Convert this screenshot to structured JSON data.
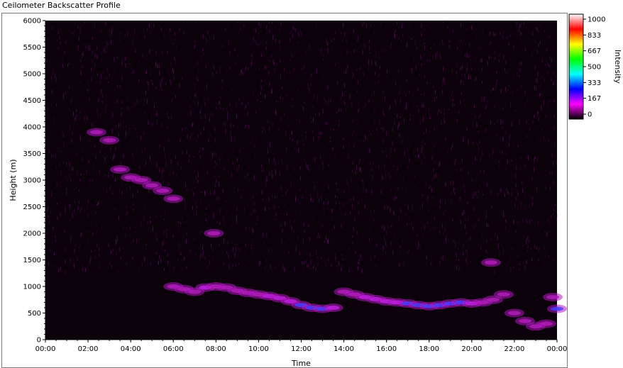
{
  "window": {
    "title": "Ceilometer Backscatter Profile"
  },
  "chart_data": {
    "type": "heatmap",
    "title": "Ceilometer Backscatter Profile",
    "xlabel": "Time",
    "ylabel": "Height (m)",
    "x_ticks": [
      "00:00",
      "02:00",
      "04:00",
      "06:00",
      "08:00",
      "10:00",
      "12:00",
      "14:00",
      "16:00",
      "18:00",
      "20:00",
      "22:00",
      "00:00"
    ],
    "x_range_hours": [
      0,
      24
    ],
    "y_ticks": [
      0,
      500,
      1000,
      1500,
      2000,
      2500,
      3000,
      3500,
      4000,
      4500,
      5000,
      5500,
      6000
    ],
    "ylim": [
      0,
      6000
    ],
    "colorbar": {
      "label": "Intensity",
      "ticks": [
        0,
        167,
        333,
        500,
        667,
        833,
        1000
      ],
      "range": [
        0,
        1000
      ],
      "colors": [
        "#000000",
        "#ff00ff",
        "#0000ff",
        "#00ffff",
        "#00ff00",
        "#ffff00",
        "#ff0000",
        "#ffffff"
      ]
    },
    "grid": false,
    "features": [
      {
        "name": "main-layer",
        "points": [
          [
            6.0,
            1000,
            300
          ],
          [
            6.5,
            950,
            320
          ],
          [
            7.0,
            900,
            300
          ],
          [
            7.5,
            980,
            330
          ],
          [
            8.0,
            1000,
            320
          ],
          [
            8.5,
            980,
            300
          ],
          [
            9.0,
            920,
            300
          ],
          [
            9.5,
            880,
            300
          ],
          [
            10.0,
            850,
            310
          ],
          [
            10.5,
            820,
            330
          ],
          [
            11.0,
            780,
            360
          ],
          [
            11.5,
            720,
            380
          ],
          [
            12.0,
            650,
            420
          ],
          [
            12.5,
            600,
            460
          ],
          [
            13.0,
            580,
            440
          ],
          [
            13.5,
            600,
            380
          ],
          [
            14.0,
            900,
            320
          ],
          [
            14.5,
            850,
            320
          ],
          [
            15.0,
            800,
            330
          ],
          [
            15.5,
            760,
            340
          ],
          [
            16.0,
            720,
            360
          ],
          [
            16.5,
            700,
            380
          ],
          [
            17.0,
            680,
            400
          ],
          [
            17.5,
            650,
            420
          ],
          [
            18.0,
            630,
            440
          ],
          [
            18.5,
            650,
            440
          ],
          [
            19.0,
            680,
            430
          ],
          [
            19.5,
            700,
            420
          ],
          [
            20.0,
            680,
            380
          ],
          [
            20.5,
            700,
            320
          ],
          [
            21.0,
            750,
            300
          ],
          [
            21.5,
            850,
            320
          ],
          [
            22.0,
            500,
            280
          ],
          [
            22.5,
            350,
            240
          ],
          [
            23.0,
            250,
            220
          ],
          [
            23.5,
            300,
            220
          ],
          [
            23.8,
            800,
            300
          ],
          [
            24.0,
            580,
            420
          ]
        ]
      },
      {
        "name": "elevated-layer",
        "points": [
          [
            2.4,
            3900,
            230
          ],
          [
            3.0,
            3750,
            200
          ],
          [
            3.5,
            3200,
            200
          ],
          [
            4.0,
            3050,
            200
          ],
          [
            4.5,
            3000,
            200
          ],
          [
            5.0,
            2900,
            200
          ],
          [
            5.5,
            2800,
            180
          ],
          [
            6.0,
            2650,
            170
          ],
          [
            7.9,
            2000,
            150
          ],
          [
            20.9,
            1450,
            180
          ]
        ]
      }
    ]
  }
}
